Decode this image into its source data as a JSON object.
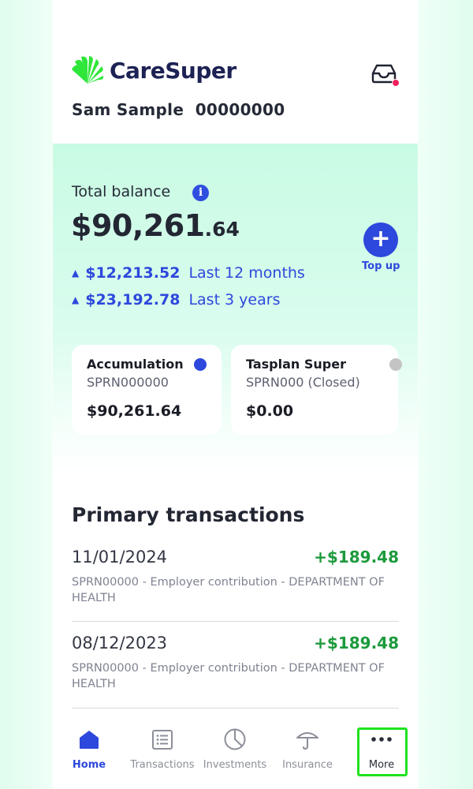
{
  "brand": {
    "name": "CareSuper"
  },
  "member": {
    "name": "Sam Sample",
    "number": "00000000"
  },
  "balance": {
    "label": "Total balance",
    "amount_main": "$90,261",
    "amount_cents": ".64",
    "growth": [
      {
        "value": "$12,213.52",
        "period": "Last 12 months"
      },
      {
        "value": "$23,192.78",
        "period": "Last 3 years"
      }
    ],
    "topup_label": "Top up"
  },
  "accounts": [
    {
      "title": "Accumulation",
      "sprn": "SPRN000000",
      "amount": "$90,261.64",
      "dot_color": "#2d48dc"
    },
    {
      "title": "Tasplan Super",
      "sprn": "SPRN000 (Closed)",
      "amount": "$0.00",
      "dot_color": "#c4c4c4"
    }
  ],
  "transactions": {
    "heading": "Primary transactions",
    "items": [
      {
        "date": "11/01/2024",
        "amount": "+$189.48",
        "description": "SPRN00000 - Employer contribution - DEPARTMENT OF HEALTH"
      },
      {
        "date": "08/12/2023",
        "amount": "+$189.48",
        "description": "SPRN00000 - Employer contribution - DEPARTMENT OF HEALTH"
      }
    ]
  },
  "nav": {
    "items": [
      {
        "label": "Home",
        "icon": "home-icon"
      },
      {
        "label": "Transactions",
        "icon": "list-icon"
      },
      {
        "label": "Investments",
        "icon": "pie-chart-icon"
      },
      {
        "label": "Insurance",
        "icon": "umbrella-icon"
      },
      {
        "label": "More",
        "icon": "more-dots-icon"
      }
    ],
    "active": "Home"
  },
  "colors": {
    "accent": "#2d48dc",
    "positive": "#1c9a3c",
    "notification": "#f0215f",
    "brand_green": "#2ee63a"
  }
}
